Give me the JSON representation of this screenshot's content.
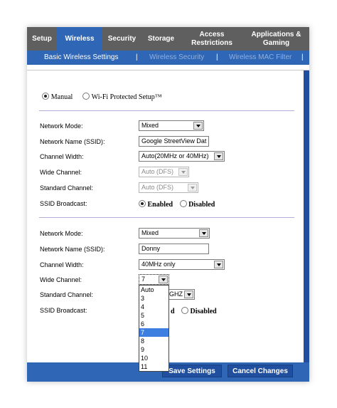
{
  "topnav": {
    "tabs": [
      {
        "label": "Setup",
        "active": false
      },
      {
        "label": "Wireless",
        "active": true
      },
      {
        "label": "Security",
        "active": false
      },
      {
        "label": "Storage",
        "active": false
      },
      {
        "label": "Access\nRestrictions",
        "active": false
      },
      {
        "label": "Applications &\nGaming",
        "active": false
      }
    ]
  },
  "subnav": {
    "items": [
      {
        "label": "Basic Wireless Settings",
        "active": true
      },
      {
        "label": "Wireless Security",
        "active": false
      },
      {
        "label": "Wireless MAC Filter",
        "active": false
      }
    ],
    "separator": "|"
  },
  "config_mode": {
    "manual_label": "Manual",
    "wps_label": "Wi-Fi Protected Setup™",
    "selected": "manual"
  },
  "section1": {
    "network_mode": {
      "label": "Network Mode:",
      "value": "Mixed"
    },
    "ssid": {
      "label": "Network Name (SSID):",
      "value": "Google StreetView Dat"
    },
    "channel_width": {
      "label": "Channel Width:",
      "value": "Auto(20MHz or 40MHz)"
    },
    "wide_channel": {
      "label": "Wide Channel:",
      "value": "Auto (DFS)"
    },
    "standard_channel": {
      "label": "Standard Channel:",
      "value": "Auto (DFS)"
    },
    "ssid_broadcast": {
      "label": "SSID Broadcast:",
      "enabled_label": "Enabled",
      "disabled_label": "Disabled",
      "selected": "enabled"
    }
  },
  "section2": {
    "network_mode": {
      "label": "Network Mode:",
      "value": "Mixed"
    },
    "ssid": {
      "label": "Network Name (SSID):",
      "value": "Donny"
    },
    "channel_width": {
      "label": "Channel Width:",
      "value": "40MHz only"
    },
    "wide_channel": {
      "label": "Wide Channel:",
      "value": "7"
    },
    "standard_channel": {
      "label": "Standard Channel:",
      "visible_value": "GHZ"
    },
    "ssid_broadcast": {
      "label": "SSID Broadcast:",
      "visible_enabled_fragment": "d",
      "disabled_label": "Disabled",
      "selected": "disabled"
    }
  },
  "wide_channel_dropdown": {
    "options": [
      "Auto",
      "3",
      "4",
      "5",
      "6",
      "7",
      "8",
      "9",
      "10",
      "11"
    ],
    "highlighted": "7"
  },
  "buttons": {
    "save": "Save Settings",
    "cancel": "Cancel Changes"
  },
  "colors": {
    "nav_bg": "#5f5f5f",
    "accent_blue": "#2f66b5",
    "dark_blue": "#1f4f9e",
    "divider": "#b0aed8",
    "highlight": "#3d7fe0"
  }
}
